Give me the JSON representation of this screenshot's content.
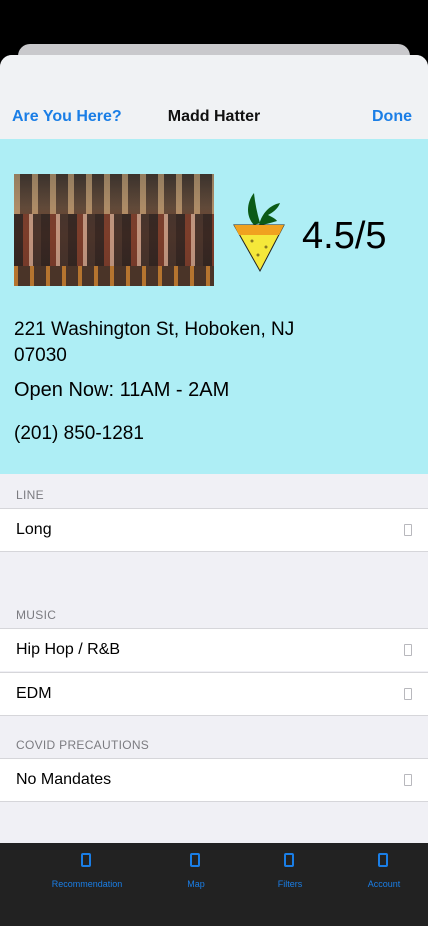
{
  "nav": {
    "left_label": "Are You Here?",
    "title": "Madd Hatter",
    "right_label": "Done"
  },
  "venue": {
    "rating": "4.5/5",
    "address": "221 Washington St, Hoboken, NJ 07030",
    "hours": "Open Now: 11AM - 2AM",
    "phone": "(201) 850-1281"
  },
  "sections": {
    "line": {
      "header": "LINE",
      "rows": [
        "Long"
      ]
    },
    "music": {
      "header": "MUSIC",
      "rows": [
        "Hip Hop / R&B",
        "EDM"
      ]
    },
    "covid": {
      "header": "COVID PRECAUTIONS",
      "rows": [
        "No Mandates"
      ]
    }
  },
  "tabs": [
    {
      "label": "Recommendation",
      "icon": "recommendation-icon"
    },
    {
      "label": "Map",
      "icon": "map-icon"
    },
    {
      "label": "Filters",
      "icon": "filters-icon"
    },
    {
      "label": "Account",
      "icon": "account-icon"
    }
  ],
  "colors": {
    "accent": "#1a7ee6",
    "info_background": "#aeeef5",
    "tabbar_background": "#222222",
    "logo_leaf": "#0b5a16",
    "logo_cone": "#f5e83a"
  }
}
